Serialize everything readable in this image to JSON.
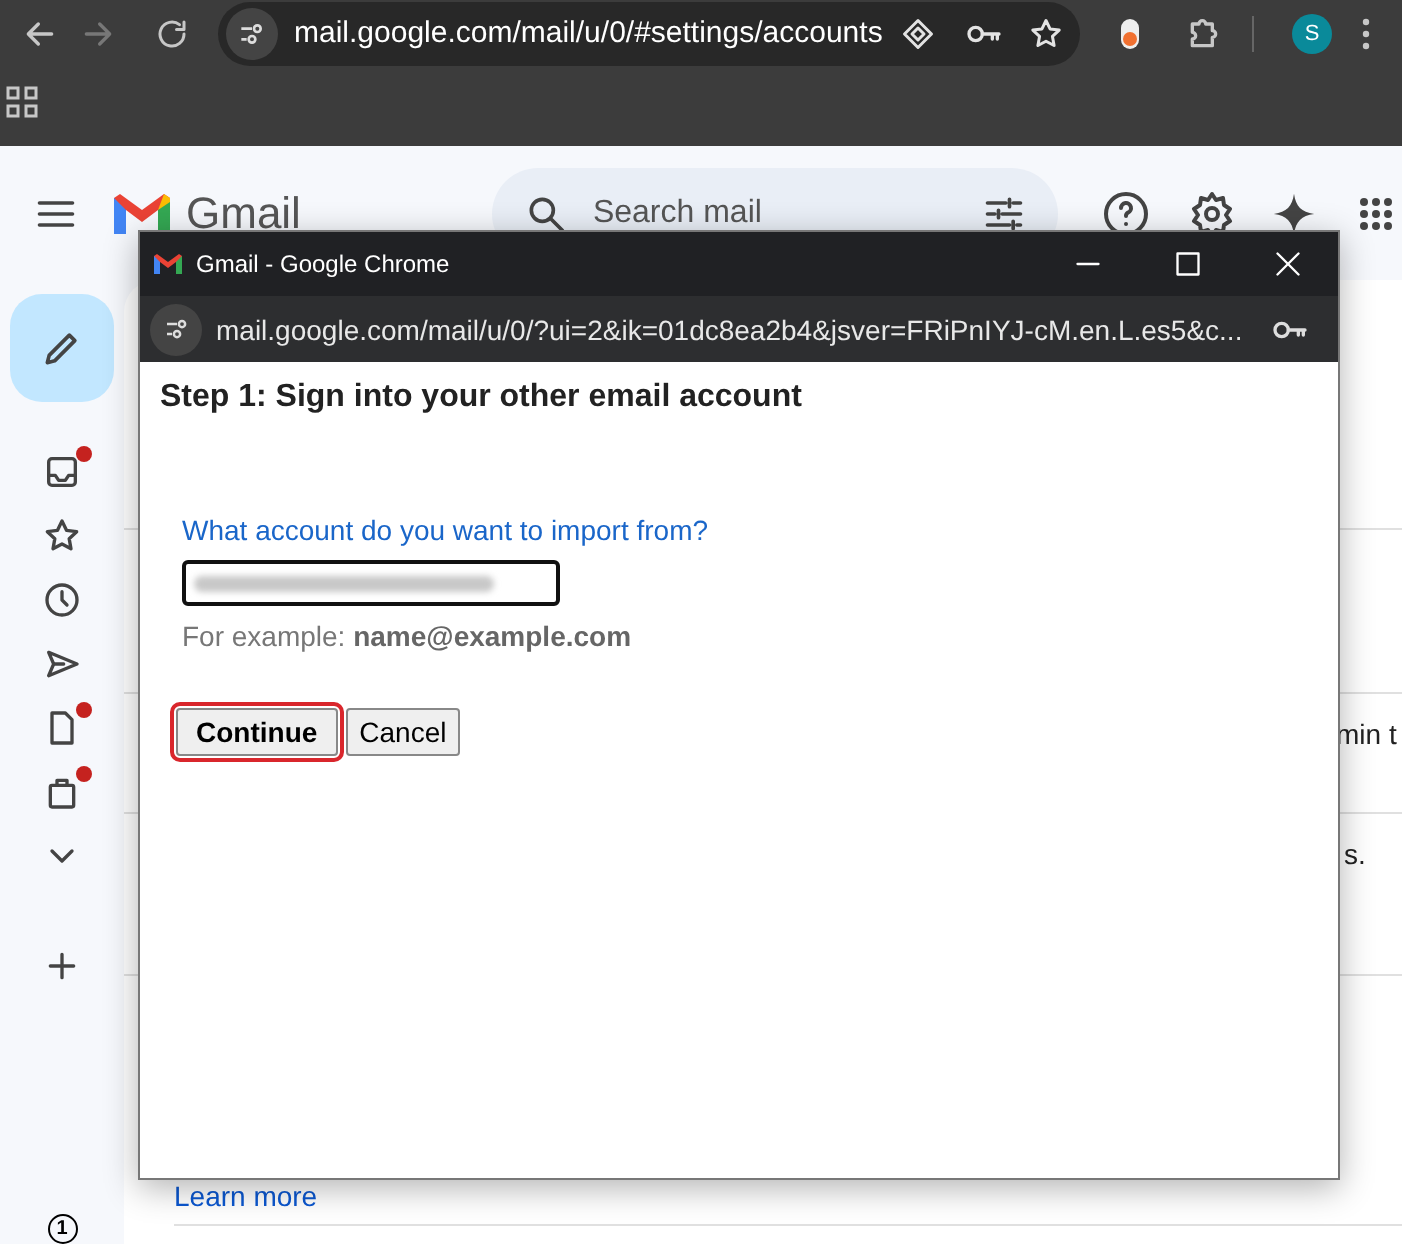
{
  "browser": {
    "url": "mail.google.com/mail/u/0/#settings/accounts",
    "profile_initial": "S"
  },
  "gmail": {
    "product_name": "Gmail",
    "search": {
      "placeholder": "Search mail"
    },
    "sidebar": [
      {
        "kind": "inbox",
        "badge": true
      },
      {
        "kind": "star",
        "badge": false
      },
      {
        "kind": "clock",
        "badge": false
      },
      {
        "kind": "send",
        "badge": false
      },
      {
        "kind": "file",
        "badge": true
      },
      {
        "kind": "bag",
        "badge": true
      },
      {
        "kind": "more",
        "badge": false
      },
      {
        "kind": "add",
        "badge": false
      }
    ],
    "bottom_badge": "1",
    "background_fragments": [
      "min t",
      "s."
    ],
    "learn_more_link": "Learn more"
  },
  "popup": {
    "title": "Gmail - Google Chrome",
    "url": "mail.google.com/mail/u/0/?ui=2&ik=01dc8ea2b4&jsver=FRiPnIYJ-cM.en.L.es5&c...",
    "heading": "Step 1: Sign into your other email account",
    "question": "What account do you want to import from?",
    "hint": "For example: **name@example.com**",
    "buttons": [
      {
        "label": "Continue",
        "highlighted": true
      },
      {
        "label": "Cancel",
        "highlighted": false
      }
    ]
  }
}
